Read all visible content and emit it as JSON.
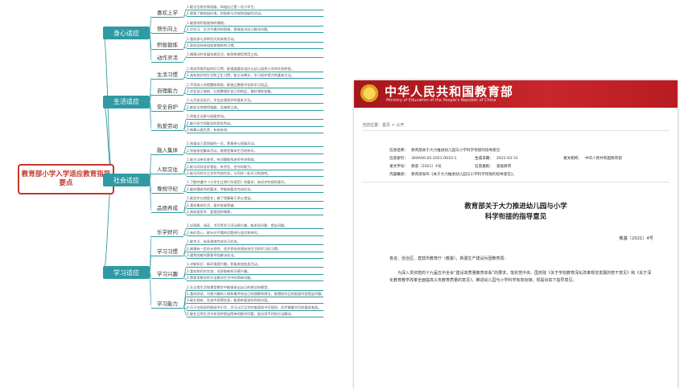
{
  "mindmap": {
    "root": "教育部小学入学适应教育指导要点",
    "categories": [
      {
        "label": "身心适应",
        "subs": [
          {
            "label": "喜欢上学",
            "items": [
              "1.能记住校名和班级，知道自己是一名小学生。",
              "2.愿意了解校园环境，积极参与学校和班级的活动。"
            ]
          },
          {
            "label": "快乐向上",
            "items": [
              "1.能保持积极愉快的情绪。",
              "2.对学习、生活中遇到的困难，愿意尝试自己解决问题。"
            ]
          },
          {
            "label": "积极锻炼",
            "items": [
              "1.喜欢参与多种形式的体育活动。",
              "2.养成坚持参加体育锻炼的习惯。"
            ]
          },
          {
            "label": "动作灵活",
            "items": [
              "1.精细动作发展协调灵活，能熟练使用常用工具。"
            ]
          }
        ]
      },
      {
        "label": "生活适应",
        "subs": [
          {
            "label": "生活习惯",
            "items": [
              "1.养成早睡早起的好习惯，能根据要求适应从幼儿园到小学的作息转变。",
              "2.具有良好的生活和卫生习惯，能主动喝水，学习保护视力的基本方法。"
            ]
          },
          {
            "label": "自理能力",
            "items": [
              "1.不用成人的提醒和帮助，能独立整理书包和学习用品。",
              "2.学会自己收纳，分类整理好自己的物品，做好课前准备。"
            ]
          },
          {
            "label": "安全自护",
            "items": [
              "1.认识安全标识，学会自我保护的基本方法。",
              "2.能安全地使用电器、设施和工具。"
            ]
          },
          {
            "label": "热爱劳动",
            "items": [
              "1.积极主动参与班级劳动。",
              "2.能分担力所能及的家务劳动。",
              "3.做事认真负责，有始有终。"
            ]
          }
        ]
      },
      {
        "label": "社会适应",
        "subs": [
          {
            "label": "融入集体",
            "items": [
              "1.知道自己是班级的一员，愿意参与班级活动。",
              "2.积极参加集体活动，能感受集体生活的快乐。"
            ]
          },
          {
            "label": "人际交往",
            "items": [
              "1.能主动亲近老师，有问题能找老师寻求帮助。",
              "2.能与同伴友好相处，有交往、合作的能力。",
              "3.能与同伴分工合作完成任务，与同伴一起学习和游戏。"
            ]
          },
          {
            "label": "尊规守纪",
            "items": [
              "1.了解并遵守《小学生日常行为规范》的要求，有初步的规则意识。",
              "2.能听懂老师的要求，并能按要求完成任务。"
            ]
          },
          {
            "label": "品德养成",
            "items": [
              "1.能初步分辨是非，做了错事敢于承认错误。",
              "2.喜欢集体生活，爱护班级荣誉。",
              "3.具有爱家乡、爱祖国的情感。"
            ]
          }
        ]
      },
      {
        "label": "学习适应",
        "subs": [
          {
            "label": "乐学好问",
            "items": [
              "1.对观察、阅读、书写等学习活动感兴趣，能发现问题、提出问题。",
              "2.有好奇心，能针对不懂的问题进行追问和探究。"
            ]
          },
          {
            "label": "学习习惯",
            "items": [
              "1.能专注、有条理地完成学习任务。",
              "2.做事有一定的计划性，逐步养成合理安排生活和学习的习惯。",
              "3.遇到困难时愿意寻找解决办法。"
            ]
          },
          {
            "label": "学习兴趣",
            "items": [
              "1.对新知识、新环境感兴趣，积极参加各类活动。",
              "2.喜欢和同学交流，对获取新知识感兴趣。",
              "3.愿意用数学的方法解决生活中的简单问题。"
            ]
          },
          {
            "label": "学习能力",
            "items": [
              "1.在日常生活和课堂教学中能够说出自己的想法和感受。",
              "2.喜欢阅读，对感兴趣的人物和事件有自己的理解和想法，能围绕作品的画面内容提出问题。",
              "3.能在倾听、交流中获得信息，能简单复述听到的内容。",
              "4.乐于在阅读的图画中识字，学习认识汉字的笔画和书写规则，初步掌握书写的基本笔画。",
              "5.能在日常生活中发现并提出简单的数学问题，尝试用不同的方法解决。"
            ]
          }
        ]
      }
    ]
  },
  "document": {
    "site_title": "中华人民共和国教育部",
    "site_title_en": "Ministry of Education of the People's Republic of China",
    "breadcrumb": "当前位置：首页 > 公开",
    "meta": {
      "index_label": "信息名称：",
      "index_value": "教育部关于大力推进幼儿园与小学科学衔接的指导意见",
      "id_label": "信息索引：",
      "id_value": "360A06-05-2021-0010-1",
      "date_label": "生成日期：",
      "date_value": "2021-03-31",
      "org_label": "发文机构：",
      "org_value": "中华人民共和国教育部",
      "doc_label": "发文字号：",
      "doc_value": "教基〔2021〕4号",
      "cat_label": "信息类别：",
      "cat_value": "基础教育",
      "summary_label": "内容概述：",
      "summary_value": "教育部发布《关于大力推进幼儿园与小学科学衔接的指导意见》。"
    },
    "heading_1": "教育部关于大力推进幼儿园与小学",
    "heading_2": "科学衔接的指导意见",
    "doc_number": "教基〔2021〕4号",
    "salutation": "各省、自治区、直辖市教育厅（教委），新疆生产建设兵团教育局：",
    "body_1": "为深入贯彻党的十九届五中全会“建设高质量教育体系”的要求，落实党中央、国务院《关于学前教育深化改革规范发展的若干意见》和《关于深化教育教学改革全面提高义务教育质量的意见》，推进幼儿园与小学科学有效衔接，现提出如下指导意见。"
  }
}
